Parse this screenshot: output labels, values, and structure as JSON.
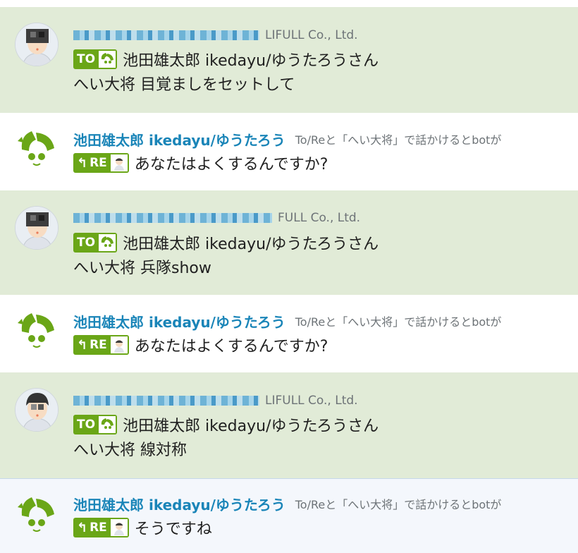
{
  "colors": {
    "mention_bg": "#e1ebd7",
    "name_blue": "#1a85b8",
    "badge_green": "#6aa617"
  },
  "messages": [
    {
      "kind": "mention",
      "org": "LIFULL Co., Ltd.",
      "tag": "TO",
      "to_name": "池田雄太郎 ikedayu/ゆうたろうさん",
      "text": "へい大将 目覚ましをセットして"
    },
    {
      "kind": "bot",
      "sender": "池田雄太郎 ikedayu/ゆうたろう",
      "hint": "To/Reと「へい大将」で話かけるとbotが",
      "tag": "RE",
      "text": "あなたはよくするんですか?"
    },
    {
      "kind": "mention",
      "org": "FULL Co., Ltd.",
      "tag": "TO",
      "to_name": "池田雄太郎 ikedayu/ゆうたろうさん",
      "text": "へい大将 兵隊show"
    },
    {
      "kind": "bot",
      "sender": "池田雄太郎 ikedayu/ゆうたろう",
      "hint": "To/Reと「へい大将」で話かけるとbotが",
      "tag": "RE",
      "text": "あなたはよくするんですか?"
    },
    {
      "kind": "mention",
      "org": "LIFULL Co., Ltd.",
      "tag": "TO",
      "to_name": "池田雄太郎 ikedayu/ゆうたろうさん",
      "text": "へい大将 線対称"
    },
    {
      "kind": "bot",
      "sender": "池田雄太郎 ikedayu/ゆうたろう",
      "hint": "To/Reと「へい大将」で話かけるとbotが",
      "tag": "RE",
      "text": "そうですね"
    }
  ]
}
